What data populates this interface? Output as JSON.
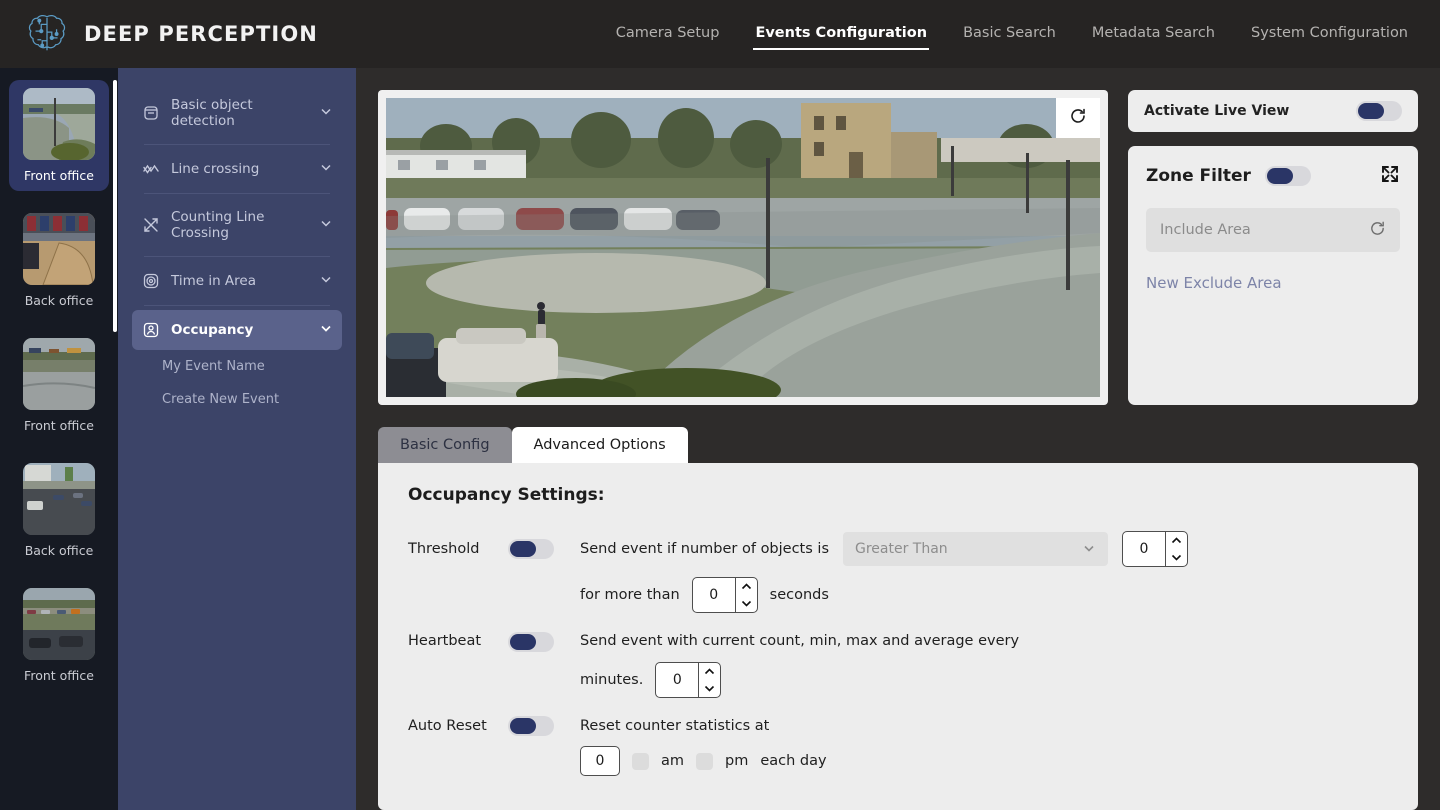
{
  "header": {
    "brand": "DEEP PERCEPTION",
    "logo_icon": "brain-circuit-icon",
    "nav": [
      {
        "label": "Camera Setup",
        "active": false
      },
      {
        "label": "Events Configuration",
        "active": true
      },
      {
        "label": "Basic Search",
        "active": false
      },
      {
        "label": "Metadata Search",
        "active": false
      },
      {
        "label": "System Configuration",
        "active": false
      }
    ]
  },
  "cameras": [
    {
      "label": "Front office",
      "active": true,
      "scene": "walkway"
    },
    {
      "label": "Back office",
      "active": false,
      "scene": "gym"
    },
    {
      "label": "Front office",
      "active": false,
      "scene": "road"
    },
    {
      "label": "Back office",
      "active": false,
      "scene": "lot"
    },
    {
      "label": "Front office",
      "active": false,
      "scene": "parking"
    }
  ],
  "event_types": [
    {
      "label": "Basic object detection",
      "icon": "object-box-icon",
      "active": false
    },
    {
      "label": "Line crossing",
      "icon": "zigzag-line-icon",
      "active": false
    },
    {
      "label": "Counting Line Crossing",
      "icon": "crossing-arrows-icon",
      "active": false
    },
    {
      "label": "Time in Area",
      "icon": "target-circle-icon",
      "active": false
    },
    {
      "label": "Occupancy",
      "icon": "person-box-icon",
      "active": true
    }
  ],
  "event_subitems": [
    {
      "label": "My Event Name"
    },
    {
      "label": "Create New Event"
    }
  ],
  "video": {
    "refresh_icon": "refresh-icon"
  },
  "live_view": {
    "label": "Activate Live View",
    "toggle_on": false
  },
  "zone_filter": {
    "title": "Zone Filter",
    "toggle_on": false,
    "expand_icon": "expand-icon",
    "include_placeholder": "Include Area",
    "include_refresh_icon": "refresh-icon",
    "exclude_link": "New Exclude Area"
  },
  "tabs": [
    {
      "label": "Basic Config",
      "active": false
    },
    {
      "label": "Advanced Options",
      "active": true
    }
  ],
  "settings": {
    "title": "Occupancy Settings:",
    "threshold": {
      "label": "Threshold",
      "toggle_on": false,
      "text": "Send event if number of objects is",
      "comparison_placeholder": "Greater Than",
      "count_value": "0",
      "sub_prefix": "for more than",
      "seconds_value": "0",
      "sub_suffix": "seconds"
    },
    "heartbeat": {
      "label": "Heartbeat",
      "toggle_on": false,
      "text": "Send event with current count, min, max and average every",
      "minutes_label": "minutes.",
      "minutes_value": "0"
    },
    "auto_reset": {
      "label": "Auto Reset",
      "toggle_on": false,
      "text": "Reset counter statistics at",
      "hour_value": "0",
      "am_label": "am",
      "pm_label": "pm",
      "each_day_label": "each day"
    }
  },
  "colors": {
    "header_bg": "#262423",
    "page_bg": "#2e2c2b",
    "rail_bg": "#161a23",
    "event_pane_bg": "#3c4468",
    "accent_navy": "#2a3566",
    "selected_cam_bg": "#2f3765",
    "panel_bg": "#ededed",
    "logo_blue": "#5b9bc4"
  }
}
